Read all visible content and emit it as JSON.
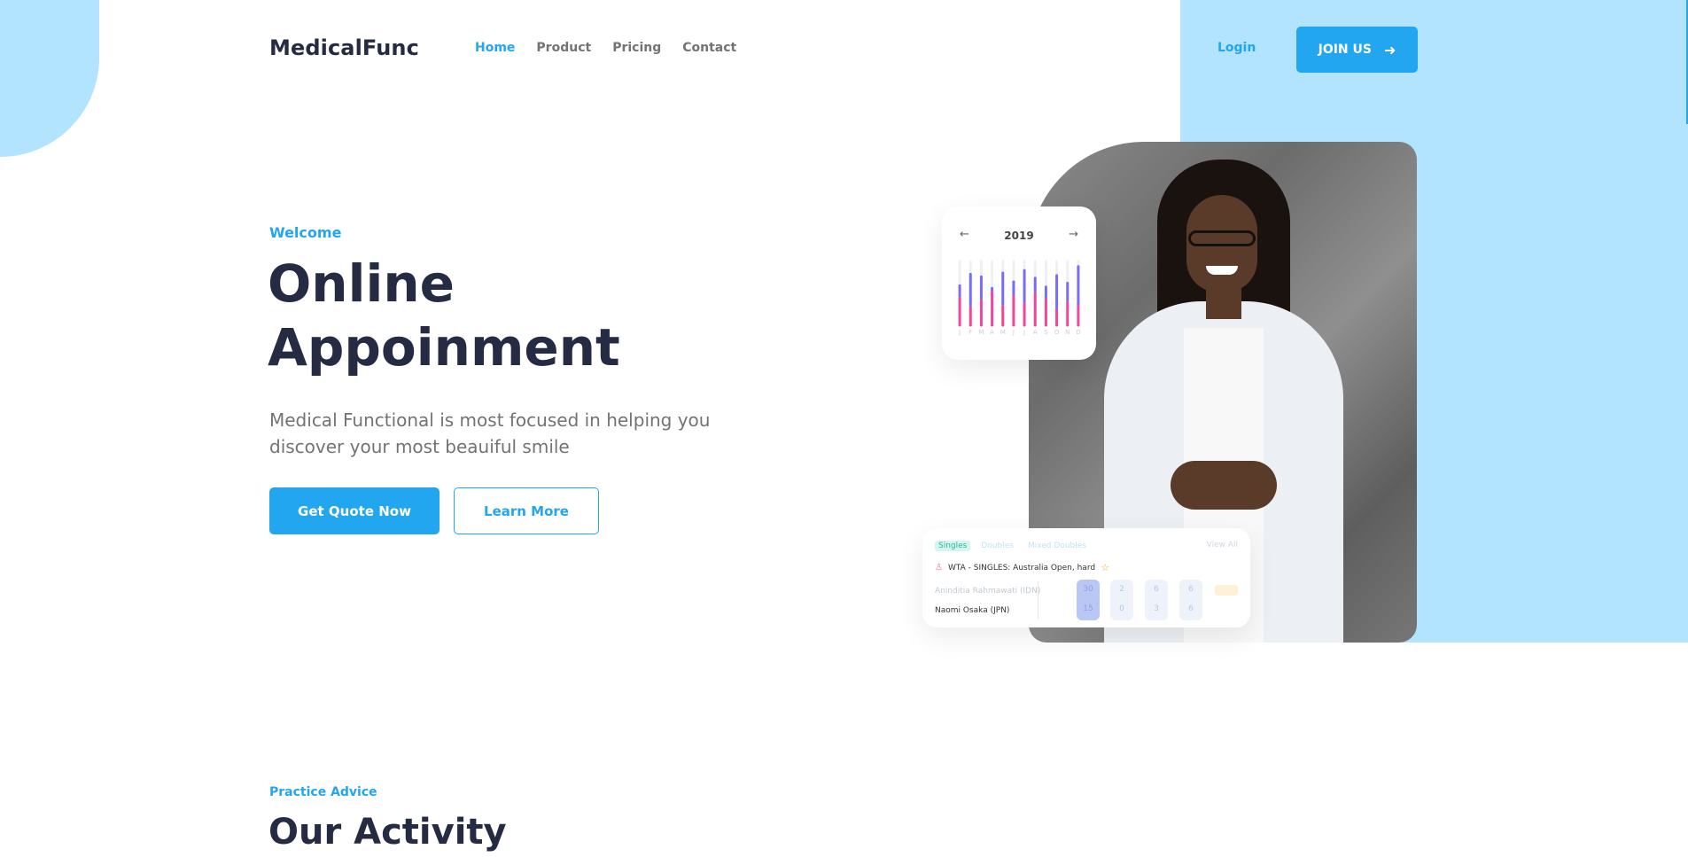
{
  "header": {
    "brand": "MedicalFunc",
    "nav": [
      {
        "label": "Home",
        "active": true
      },
      {
        "label": "Product",
        "active": false
      },
      {
        "label": "Pricing",
        "active": false
      },
      {
        "label": "Contact",
        "active": false
      }
    ],
    "login_label": "Login",
    "join_label": "JOIN US",
    "join_icon": "arrow-right-icon"
  },
  "hero": {
    "eyebrow": "Welcome",
    "title_line1": "Online",
    "title_line2": "Appoinment",
    "subtitle": "Medical Functional is most focused in helping you discover your most beauiful smile",
    "primary_button": "Get Quote Now",
    "secondary_button": "Learn More"
  },
  "chart_card": {
    "year": "2019",
    "prev_icon": "arrow-left-icon",
    "next_icon": "arrow-right-icon"
  },
  "chart_data": {
    "type": "bar",
    "categories": [
      "J",
      "F",
      "M",
      "A",
      "M",
      "J",
      "J",
      "A",
      "S",
      "O",
      "N",
      "D"
    ],
    "series": [
      {
        "values": [
          62,
          80,
          76,
          58,
          82,
          68,
          86,
          74,
          60,
          78,
          66,
          92
        ]
      },
      {
        "values": [
          42,
          28,
          38,
          52,
          30,
          46,
          34,
          50,
          40,
          24,
          36,
          30
        ]
      }
    ]
  },
  "match_card": {
    "tabs": [
      "Singles",
      "Doubles",
      "Mixed Doubles"
    ],
    "active_tab": "Singles",
    "view_all": "View All",
    "event": "WTA - SINGLES: Australia Open, hard",
    "player1": "Aninditia Rahmawati (IDN)",
    "player2": "Naomi Osaka (JPN)",
    "sets": [
      {
        "top": "30",
        "bottom": "15"
      },
      {
        "top": "2",
        "bottom": "0"
      },
      {
        "top": "6",
        "bottom": "3"
      },
      {
        "top": "6",
        "bottom": "6"
      }
    ]
  },
  "next_section": {
    "eyebrow": "Practice Advice",
    "title": "Our Activity"
  },
  "colors": {
    "accent": "#23A6F0",
    "panel": "#B2E3FF",
    "dark": "#252B42",
    "muted": "#737373"
  }
}
